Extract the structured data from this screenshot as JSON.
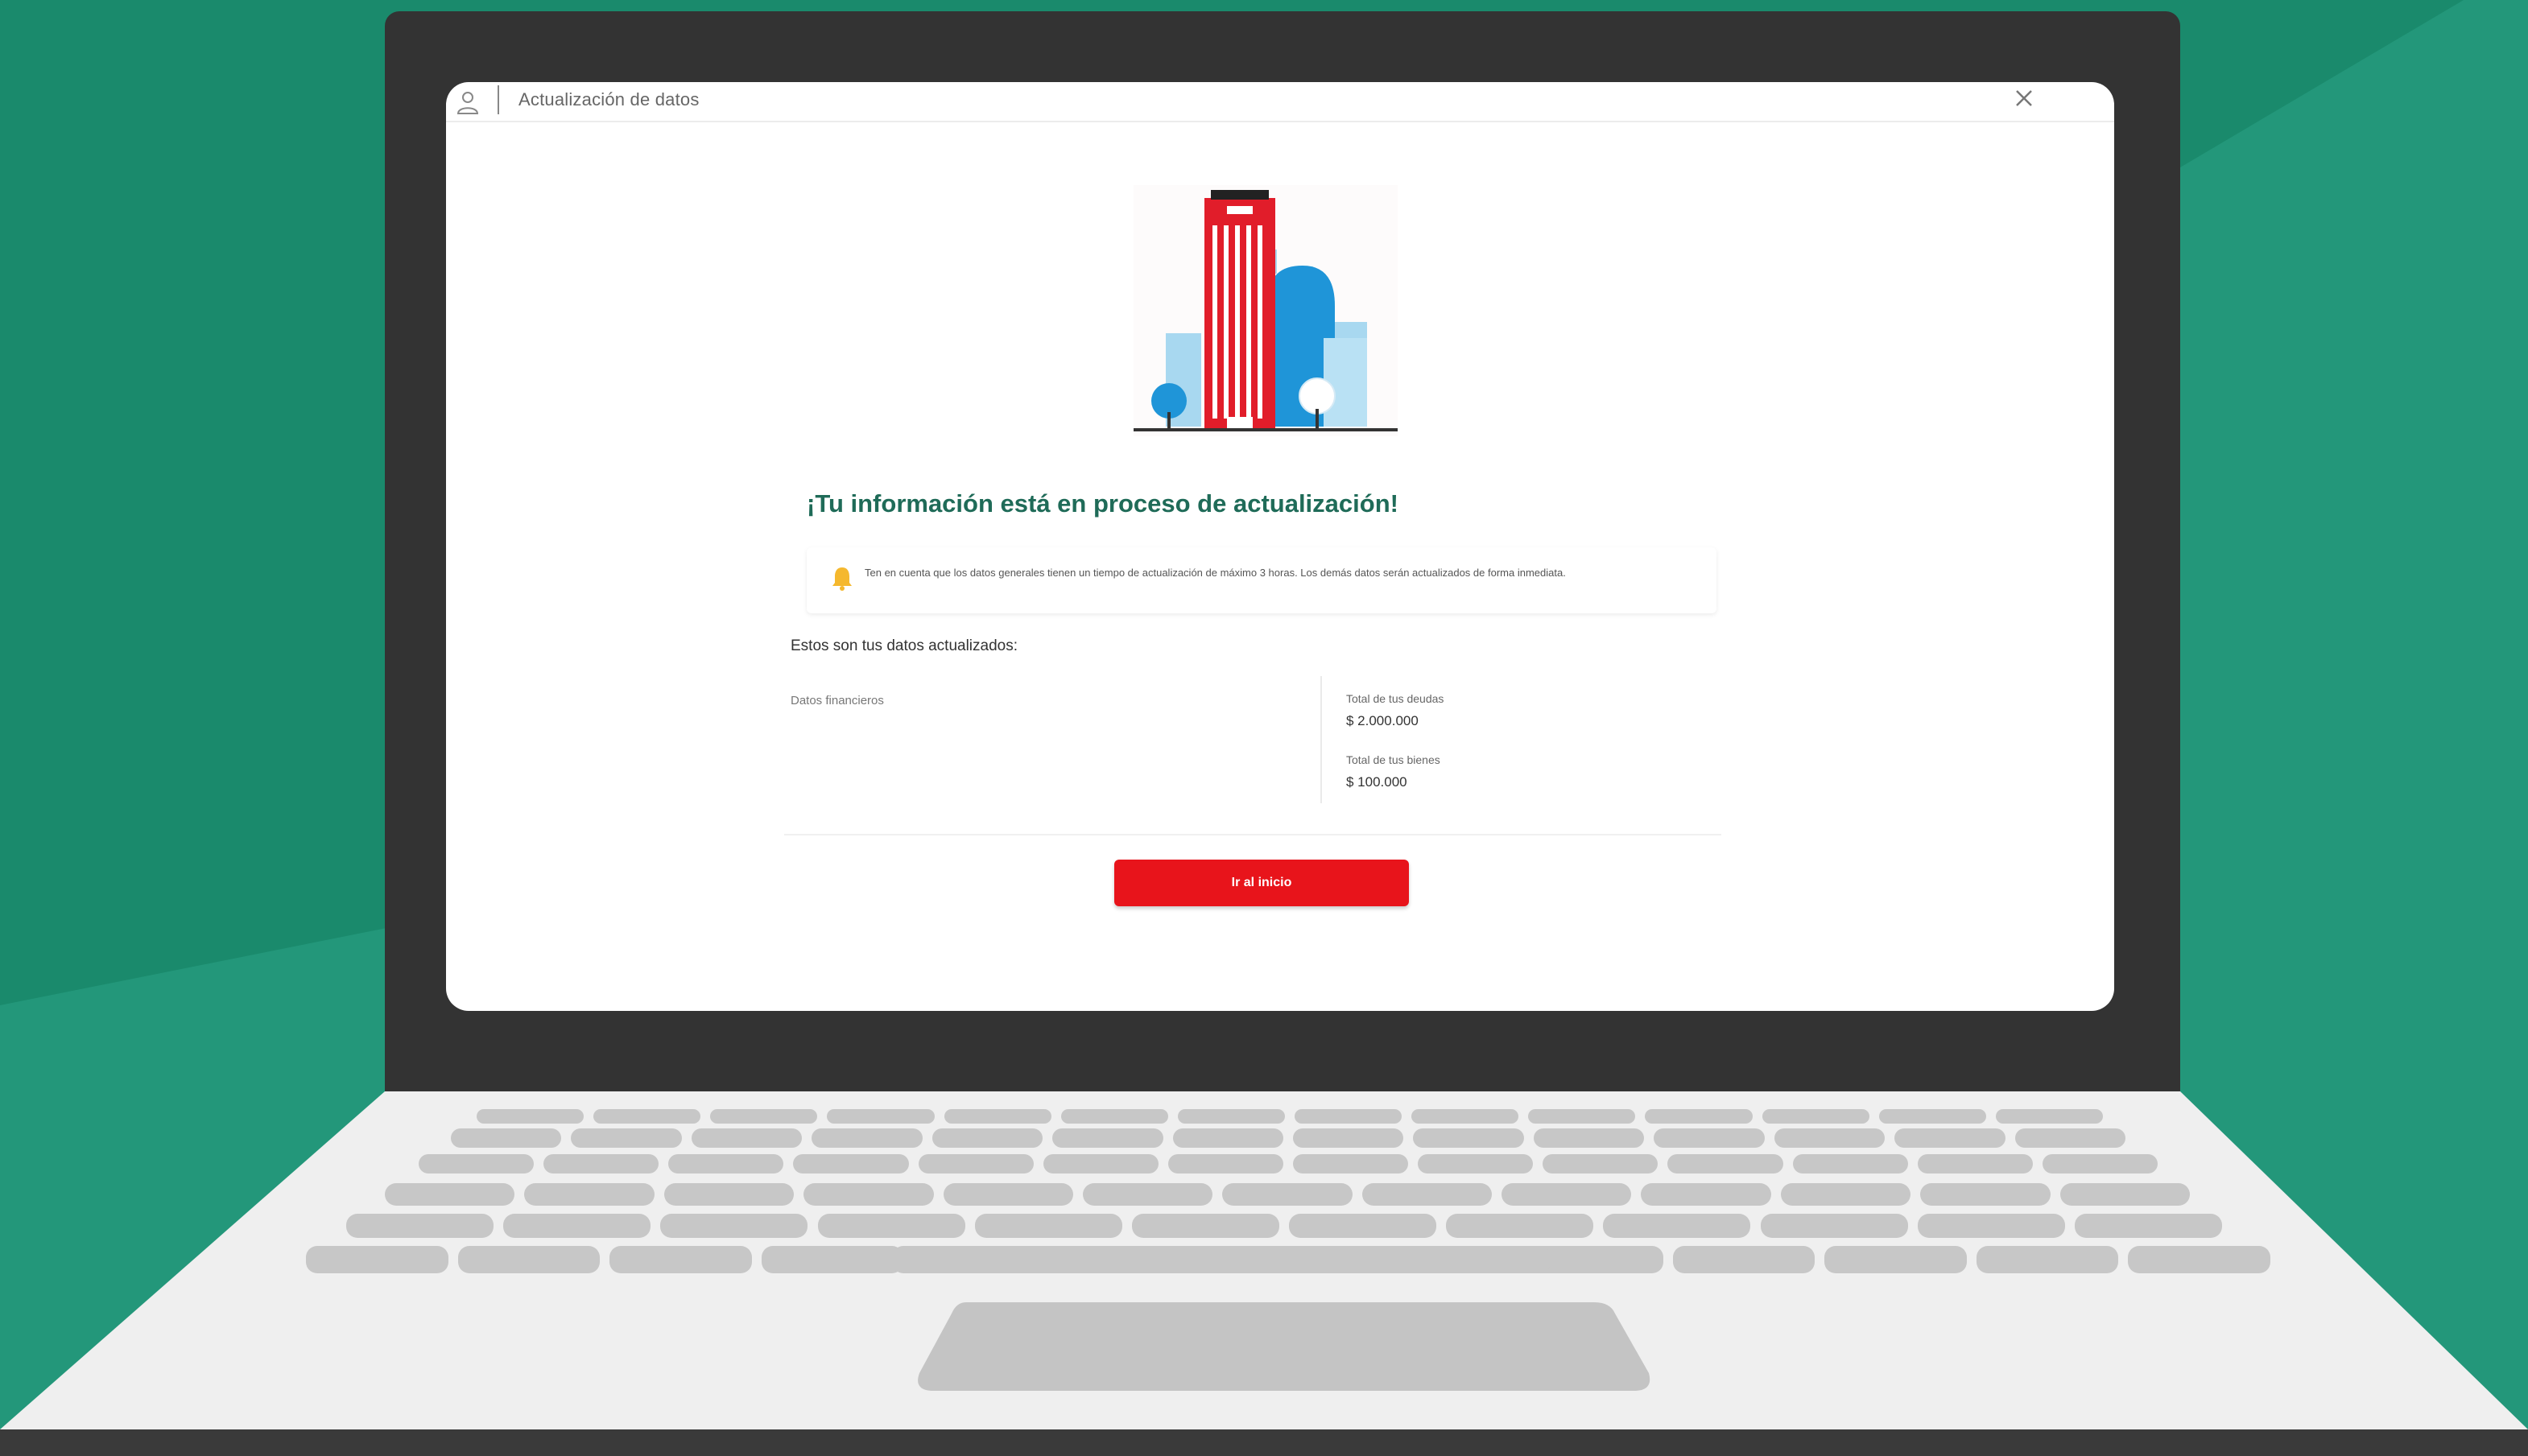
{
  "window": {
    "title": "Actualización de datos"
  },
  "confirmation": {
    "headline": "¡Tu información está en proceso de actualización!",
    "notice": "Ten en cuenta que los datos generales tienen un tiempo de actualización de máximo 3 horas. Los demás datos serán actualizados de forma inmediata."
  },
  "summary": {
    "section_title": "Estos son tus datos actualizados:",
    "category": "Datos financieros",
    "fields": [
      {
        "label": "Total de tus deudas",
        "value": "$ 2.000.000"
      },
      {
        "label": "Total de tus bienes",
        "value": "$ 100.000"
      }
    ]
  },
  "actions": {
    "home_button": "Ir al inicio"
  },
  "colors": {
    "background": "#1a8a6c",
    "accent": "#e8141b",
    "headline": "#1f6b58"
  },
  "icons": [
    "user-icon",
    "close-icon",
    "bell-icon"
  ]
}
